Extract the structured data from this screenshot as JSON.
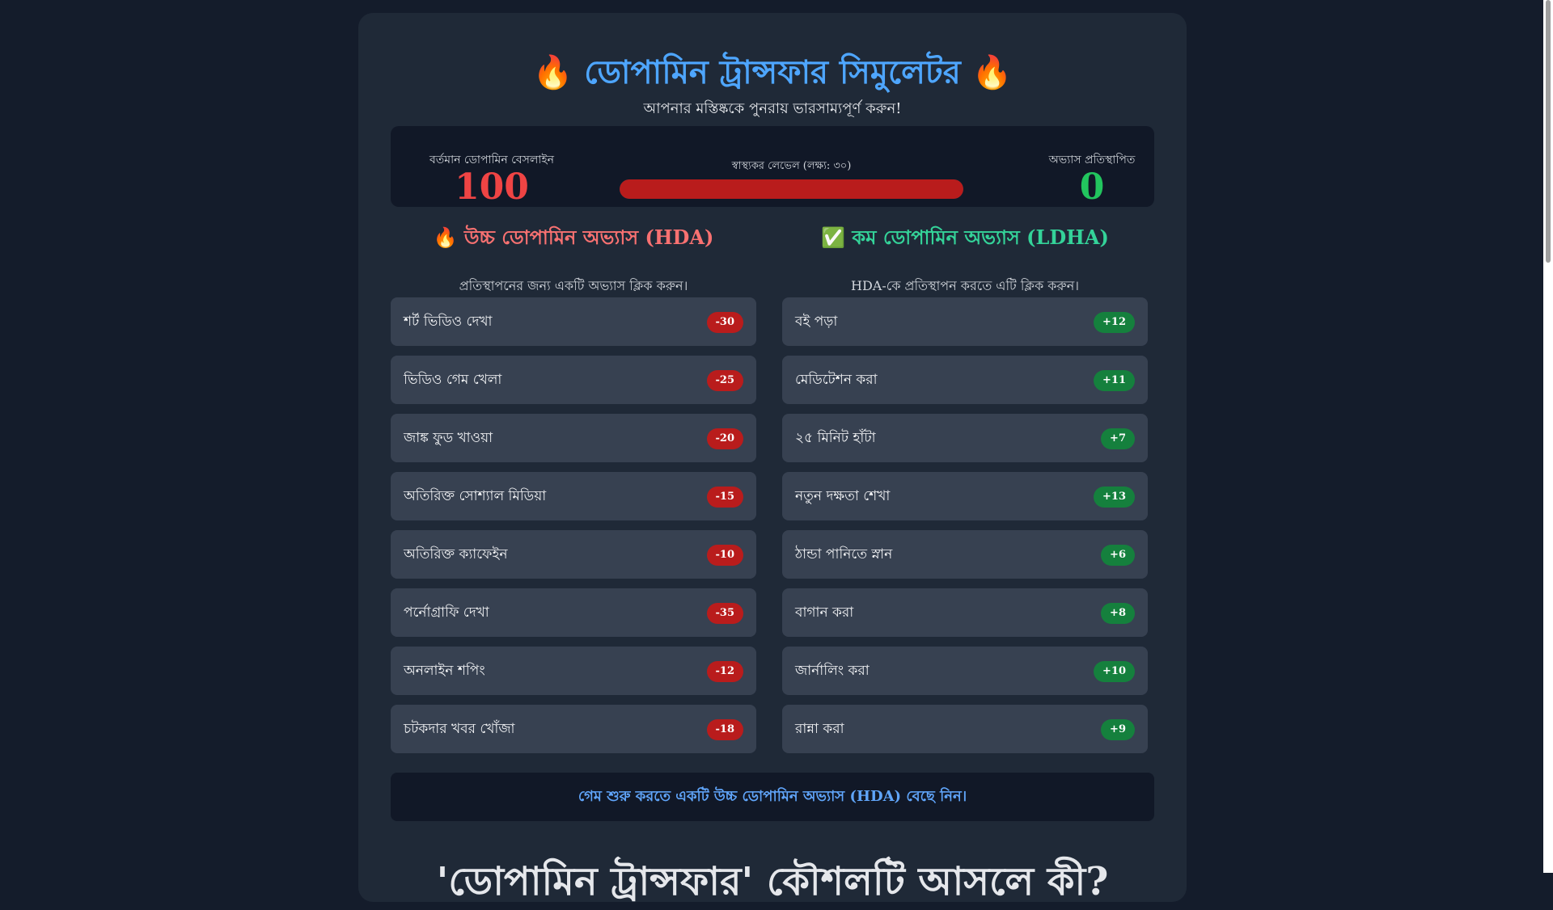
{
  "header": {
    "title": "🔥 ডোপামিন ট্রান্সফার সিমুলেটর 🔥",
    "subtitle": "আপনার মস্তিষ্ককে পুনরায় ভারসাম্যপূর্ণ করুন!"
  },
  "stats": {
    "baseline_label": "বর্তমান ডোপামিন বেসলাইন",
    "baseline_value": "100",
    "health_label": "স্বাস্থ্যকর লেভেল (লক্ষ্য: ৩০)",
    "health_progress": 1.0,
    "replaced_label": "অভ্যাস প্রতিস্থাপিত",
    "replaced_value": "0"
  },
  "hda": {
    "heading": "🔥 উচ্চ ডোপামিন অভ্যাস (HDA)",
    "instruction": "প্রতিস্থাপনের জন্য একটি অভ্যাস ক্লিক করুন।",
    "items": [
      {
        "label": "শর্ট ভিডিও দেখা",
        "value": "-30"
      },
      {
        "label": "ভিডিও গেম খেলা",
        "value": "-25"
      },
      {
        "label": "জাঙ্ক ফুড খাওয়া",
        "value": "-20"
      },
      {
        "label": "অতিরিক্ত সোশ্যাল মিডিয়া",
        "value": "-15"
      },
      {
        "label": "অতিরিক্ত ক্যাফেইন",
        "value": "-10"
      },
      {
        "label": "পর্নোগ্রাফি দেখা",
        "value": "-35"
      },
      {
        "label": "অনলাইন শপিং",
        "value": "-12"
      },
      {
        "label": "চটকদার খবর খোঁজা",
        "value": "-18"
      }
    ]
  },
  "ldha": {
    "heading": "✅ কম ডোপামিন অভ্যাস (LDHA)",
    "instruction": "HDA-কে প্রতিস্থাপন করতে এটি ক্লিক করুন।",
    "items": [
      {
        "label": "বই পড়া",
        "value": "+12"
      },
      {
        "label": "মেডিটেশন করা",
        "value": "+11"
      },
      {
        "label": "২৫ মিনিট হাঁটা",
        "value": "+7"
      },
      {
        "label": "নতুন দক্ষতা শেখা",
        "value": "+13"
      },
      {
        "label": "ঠান্ডা পানিতে স্নান",
        "value": "+6"
      },
      {
        "label": "বাগান করা",
        "value": "+8"
      },
      {
        "label": "জার্নালিং করা",
        "value": "+10"
      },
      {
        "label": "রান্না করা",
        "value": "+9"
      }
    ]
  },
  "message": "গেম শুরু করতে একটি উচ্চ ডোপামিন অভ্যাস (HDA) বেছে নিন।",
  "section_heading": "'ডোপামিন ট্রান্সফার' কৌশলটি আসলে কী?"
}
